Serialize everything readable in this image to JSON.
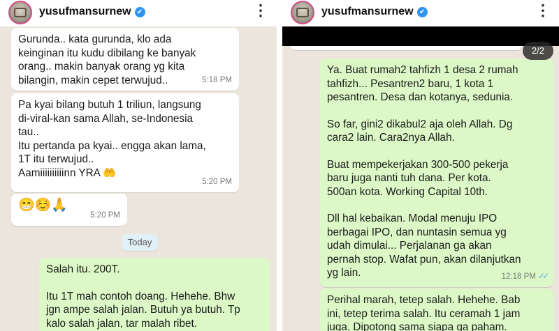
{
  "left": {
    "username": "yusufmansurnew",
    "messages": [
      {
        "text": "Gurunda.. kata gurunda, klo ada\nkeinginan itu kudu dibilang ke banyak\norang.. makin banyak orang yg kita\nbilangin, makin cepet terwujud..",
        "time": "5:18 PM"
      },
      {
        "text": "Pa kyai bilang butuh 1 triliun, langsung\ndi-viral-kan sama Allah, se-Indonesia\ntau..\nItu pertanda pa kyai.. engga akan lama,\n1T itu terwujud..",
        "text2": "Aamiiiiiiiiiinn YRA 🤲",
        "time": "5:20 PM"
      },
      {
        "text": "😁☺️🙏",
        "time": "5:20 PM"
      }
    ],
    "date_label": "Today",
    "outgoing": {
      "p1": "Salah itu. 200T.",
      "p2": "Itu 1T mah contoh doang. Hehehe. Bhw\njgn ampe salah jalan. Butuh ya butuh. Tp\nkalo salah jalan, tar malah ribet."
    }
  },
  "right": {
    "username": "yusufmansurnew",
    "counter": "2/2",
    "outgoing1": {
      "p1": "Ya. Buat rumah2 tahfizh 1 desa 2 rumah\ntahfizh... Pesantren2 baru, 1 kota 1\npesantren. Desa dan kotanya, sedunia.",
      "p2": "So far, gini2 dikabul2 aja oleh Allah. Dg\ncara2 lain. Cara2nya Allah.",
      "p3": "Buat mempekerjakan 300-500 pekerja\nbaru juga  nanti tuh dana. Per kota.\n500an kota. Working Capital 10th.",
      "p4": "Dll hal kebaikan. Modal menuju IPO\nberbagai IPO, dan nuntasin semua yg\nudah dimulai... Perjalanan ga akan\npernah stop. Wafat pun, akan dilanjutkan\nyg lain.",
      "time": "12:18 PM"
    },
    "outgoing2": {
      "text": "Perihal marah, tetep salah. Hehehe. Bab\nini, tetep terima salah. Itu ceramah 1 jam\njuga. Dipotong sama siapa ga paham."
    }
  },
  "colors": {
    "chat_bg": "#ece5dd",
    "incoming": "#ffffff",
    "outgoing": "#dcf8c6",
    "verified": "#2f95f5",
    "read_ticks": "#4fa6e7"
  },
  "icons": [
    "verified-badge-icon",
    "more-vert-icon",
    "double-check-icon"
  ]
}
